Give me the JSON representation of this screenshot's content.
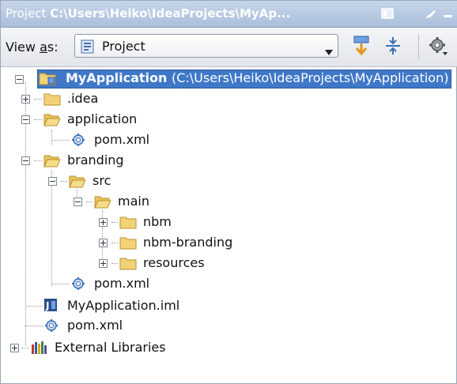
{
  "window": {
    "title_prefix": "Project",
    "title_path": "C:\\Users\\Heiko\\IdeaProjects\\MyAp..."
  },
  "toolbar": {
    "view_as_pre": "View ",
    "view_as_underlined": "a",
    "view_as_post": "s:",
    "view_select_value": "Project"
  },
  "tree": {
    "root": {
      "name": "MyApplication",
      "path": "(C:\\Users\\Heiko\\IdeaProjects\\MyApplication)"
    },
    "idea": ".idea",
    "application": "application",
    "application_pom": "pom.xml",
    "branding": "branding",
    "src": "src",
    "main": "main",
    "nbm": "nbm",
    "nbm_branding": "nbm-branding",
    "resources": "resources",
    "branding_pom": "pom.xml",
    "iml": "MyApplication.iml",
    "root_pom": "pom.xml",
    "external_libraries": "External Libraries"
  },
  "colors": {
    "titlebar": "#a9bfdc",
    "selection": "#3f78c8",
    "folder": "#f2d277"
  }
}
